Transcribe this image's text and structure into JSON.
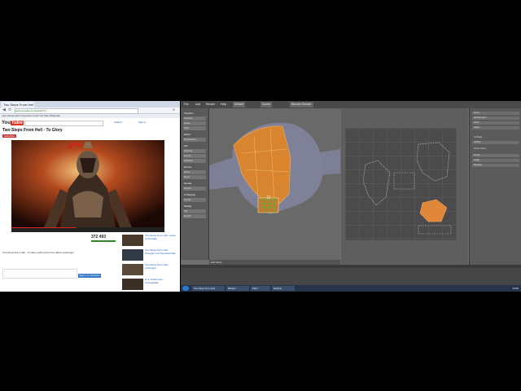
{
  "browser": {
    "tab_title": "Two Steps From Hell - To Glory",
    "url": "www.youtube.com/watch?v=... ",
    "bookmarks": "Apps  Bookmarks  Facebook  Gmail  YouTube  Wikipedia",
    "logo_you": "You",
    "logo_tube": "Tube",
    "top_links": [
      "Upload",
      "Sign in"
    ],
    "video_title": "Two Steps From Hell - To Glory",
    "channel": "Subscribe",
    "views": "372 493",
    "description": "Two Steps From Hell - To Glory (with lyrics) from album Archangel",
    "related": [
      {
        "title": "Two Steps From Hell - Heart of Courage"
      },
      {
        "title": "Two Steps From Hell - Strength of a Thousand Men"
      },
      {
        "title": "Two Steps From Hell - Archangel"
      },
      {
        "title": "E.S. Posthumus - Unstoppable"
      }
    ],
    "comment_button": "Sign in to YouTube"
  },
  "blender": {
    "menus": [
      "File",
      "Add",
      "Render",
      "Help",
      "Default",
      "Scene",
      "Blender Render"
    ],
    "tools": [
      "Transform",
      "Translate",
      "Rotate",
      "Scale",
      "Deform",
      "Shrink/Fatten",
      "Add",
      "Duplicate",
      "Extrude",
      "Subdivide",
      "Remove",
      "Delete",
      "Merge",
      "Normals",
      "Smooth",
      "UV Mapping",
      "Unwrap",
      "Shading",
      "Flat",
      "Smooth"
    ],
    "props": [
      "Scene",
      "RenderLayers",
      "World",
      "Object",
      "UV Maps",
      "UVMap",
      "Vertex Colors",
      "Texture",
      "Image",
      "Mapping"
    ],
    "status_left": "Edit Mode",
    "accent_color": "#e0873a"
  },
  "taskbar": {
    "items": [
      "Two Steps From Hell",
      "Blender",
      "Paint",
      "Explorer"
    ],
    "clock": "14:56"
  }
}
